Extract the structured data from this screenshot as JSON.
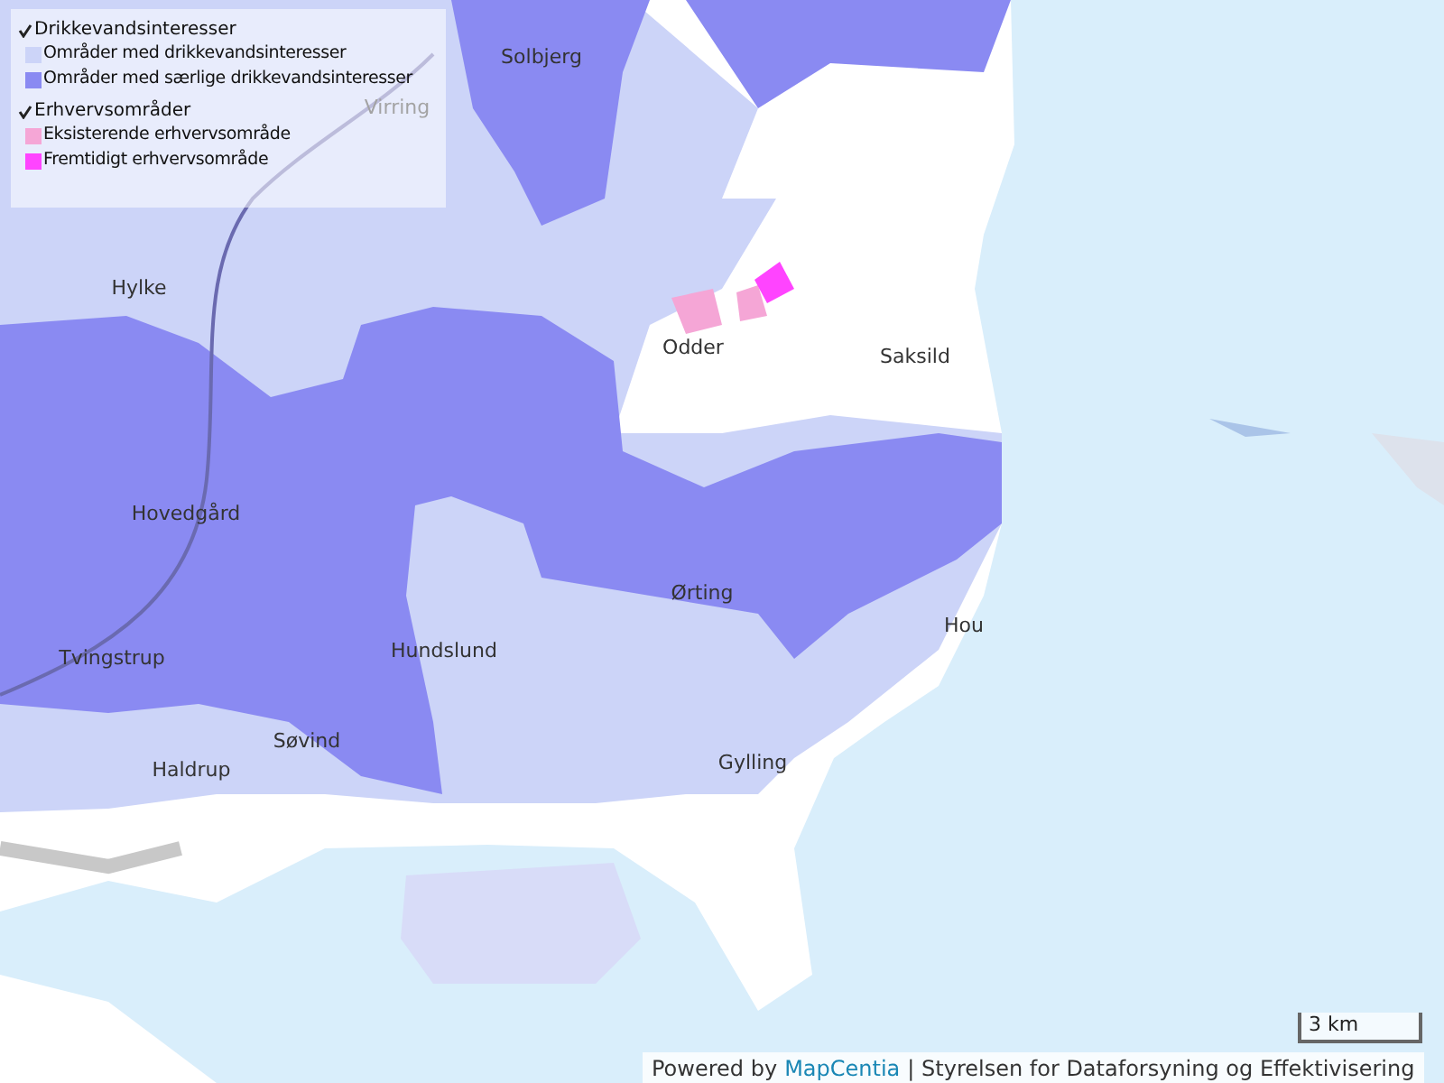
{
  "legend": {
    "groups": [
      {
        "title": "Drikkevandsinteresser",
        "checked": true,
        "items": [
          {
            "label": "Områder med drikkevandsinteresser",
            "color": "#ccd4f8"
          },
          {
            "label": "Områder med særlige drikkevandsinteresser",
            "color": "#8a8af2"
          }
        ]
      },
      {
        "title": "Erhvervsområder",
        "checked": true,
        "items": [
          {
            "label": "Eksisterende erhvervsområde",
            "color": "#f5a6d6"
          },
          {
            "label": "Fremtidigt erhvervsområde",
            "color": "#ff44ff"
          }
        ]
      }
    ]
  },
  "places": [
    {
      "name": "Solbjerg"
    },
    {
      "name": "Virring"
    },
    {
      "name": "Hylke"
    },
    {
      "name": "Odder"
    },
    {
      "name": "Saksild"
    },
    {
      "name": "Hovedgård"
    },
    {
      "name": "Ørting"
    },
    {
      "name": "Hou"
    },
    {
      "name": "Tvingstrup"
    },
    {
      "name": "Hundslund"
    },
    {
      "name": "Søvind"
    },
    {
      "name": "Haldrup"
    },
    {
      "name": "Gylling"
    }
  ],
  "scale": "3 km",
  "attribution": {
    "prefix": "Powered by",
    "link": "MapCentia",
    "suffix": "| Styrelsen for Dataforsyning og Effektivisering"
  }
}
